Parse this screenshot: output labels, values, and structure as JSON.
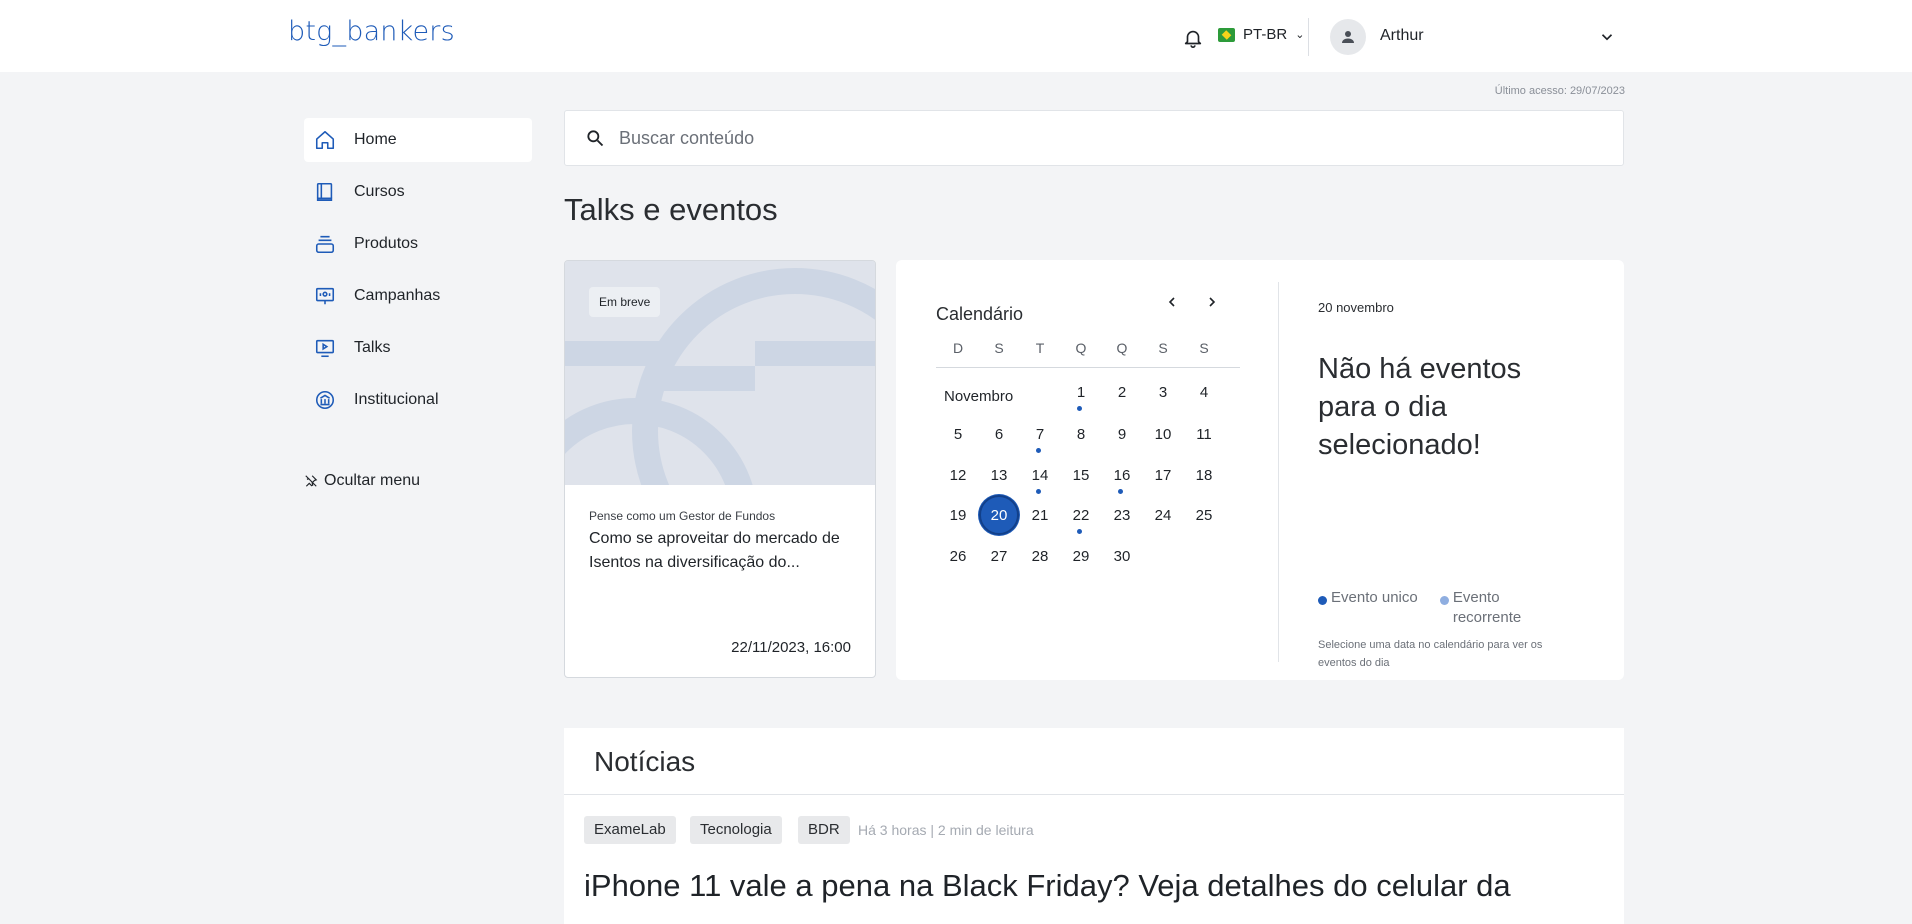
{
  "header": {
    "logo": "btg_bankers",
    "language": "PT-BR",
    "user_name": "Arthur"
  },
  "last_access": "Último acesso: 29/07/2023",
  "sidebar": {
    "items": [
      {
        "label": "Home",
        "icon": "home-icon"
      },
      {
        "label": "Cursos",
        "icon": "book-icon"
      },
      {
        "label": "Produtos",
        "icon": "stack-icon"
      },
      {
        "label": "Campanhas",
        "icon": "campaign-icon"
      },
      {
        "label": "Talks",
        "icon": "play-screen-icon"
      },
      {
        "label": "Institucional",
        "icon": "bank-icon"
      }
    ],
    "hide_menu": "Ocultar menu"
  },
  "search": {
    "placeholder": "Buscar conteúdo"
  },
  "talks": {
    "title": "Talks e eventos",
    "card": {
      "badge": "Em breve",
      "category": "Pense como um Gestor de Fundos",
      "title": "Como se aproveitar do mercado de Isentos na diversificação do...",
      "datetime": "22/11/2023, 16:00"
    },
    "calendar": {
      "title": "Calendário",
      "weekdays": [
        "D",
        "S",
        "T",
        "Q",
        "Q",
        "S",
        "S"
      ],
      "month": "Novembro",
      "weeks": [
        [
          "",
          "",
          "",
          "1",
          "2",
          "3",
          "4"
        ],
        [
          "5",
          "6",
          "7",
          "8",
          "9",
          "10",
          "11"
        ],
        [
          "12",
          "13",
          "14",
          "15",
          "16",
          "17",
          "18"
        ],
        [
          "19",
          "20",
          "21",
          "22",
          "23",
          "24",
          "25"
        ],
        [
          "26",
          "27",
          "28",
          "29",
          "30",
          "",
          ""
        ]
      ],
      "selected_day": "20",
      "event_days": [
        "1",
        "7",
        "14",
        "16",
        "22"
      ],
      "selected_date_label": "20 novembro",
      "no_events": "Não há eventos para o dia selecionado!",
      "legend": {
        "single": "Evento unico",
        "recurring": "Evento recorrente"
      },
      "hint": "Selecione uma data no calendário para ver os eventos do dia"
    }
  },
  "news": {
    "title": "Notícias",
    "tags": [
      "ExameLab",
      "Tecnologia",
      "BDR"
    ],
    "meta": "Há 3 horas | 2 min de leitura",
    "headline": "iPhone 11 vale a pena na Black Friday? Veja detalhes do celular da"
  },
  "colors": {
    "accent": "#1e5bb8",
    "recurring": "#8faee0",
    "background": "#f3f4f6"
  }
}
